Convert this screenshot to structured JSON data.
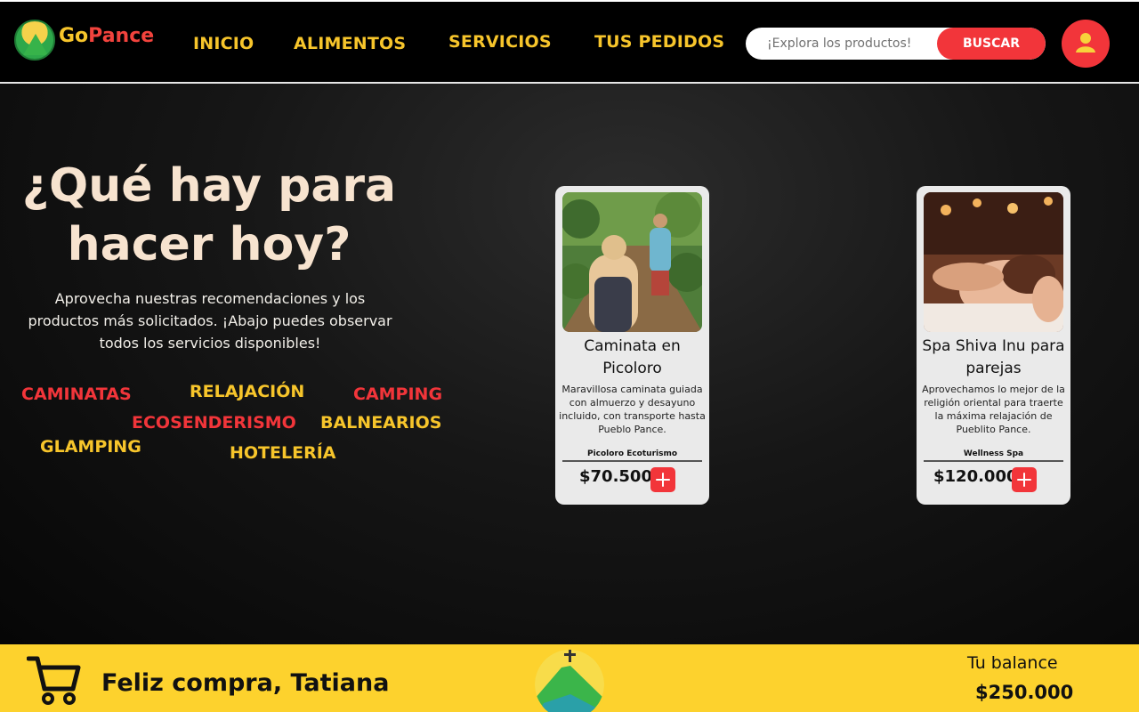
{
  "brand": {
    "go": "Go",
    "pance": "Pance"
  },
  "nav": [
    {
      "label": "INICIO"
    },
    {
      "label": "ALIMENTOS"
    },
    {
      "label": "SERVICIOS"
    },
    {
      "label": "TUS PEDIDOS"
    }
  ],
  "search": {
    "placeholder": "¡Explora los productos!",
    "button_label": "BUSCAR"
  },
  "user_icon": "user-icon",
  "hero": {
    "title": "¿Qué hay para hacer hoy?",
    "subtitle": "Aprovecha nuestras recomendaciones y los productos más solicitados. ¡Abajo puedes observar todos los servicios disponibles!"
  },
  "tags": [
    {
      "label": "CAMINATAS",
      "color": "#f2353a"
    },
    {
      "label": "RELAJACIÓN",
      "color": "#f7c52b"
    },
    {
      "label": "CAMPING",
      "color": "#f2353a"
    },
    {
      "label": "ECOSENDERISMO",
      "color": "#f2353a"
    },
    {
      "label": "BALNEARIOS",
      "color": "#f7c52b"
    },
    {
      "label": "GLAMPING",
      "color": "#f7c52b"
    },
    {
      "label": "HOTELERÍA",
      "color": "#f7c52b"
    }
  ],
  "cards": [
    {
      "title": "Caminata en Picoloro",
      "description": "Maravillosa caminata guiada con almuerzo y desayuno incluido, con transporte hasta Pueblo Pance.",
      "vendor": "Picoloro Ecoturismo",
      "price": "$70.500"
    },
    {
      "title": "Spa Shiva Inu para parejas",
      "description": "Aprovechamos lo mejor de la religión oriental para traerte la máxima relajación de Pueblito Pance.",
      "vendor": "Wellness Spa",
      "price": "$120.000"
    }
  ],
  "footer": {
    "greeting": "Feliz compra, Tatiana",
    "balance_label": "Tu balance",
    "balance_amount": "$250.000"
  },
  "colors": {
    "accent_red": "#f2353a",
    "accent_yellow": "#f7c52b",
    "footer_bg": "#fdd22d"
  }
}
